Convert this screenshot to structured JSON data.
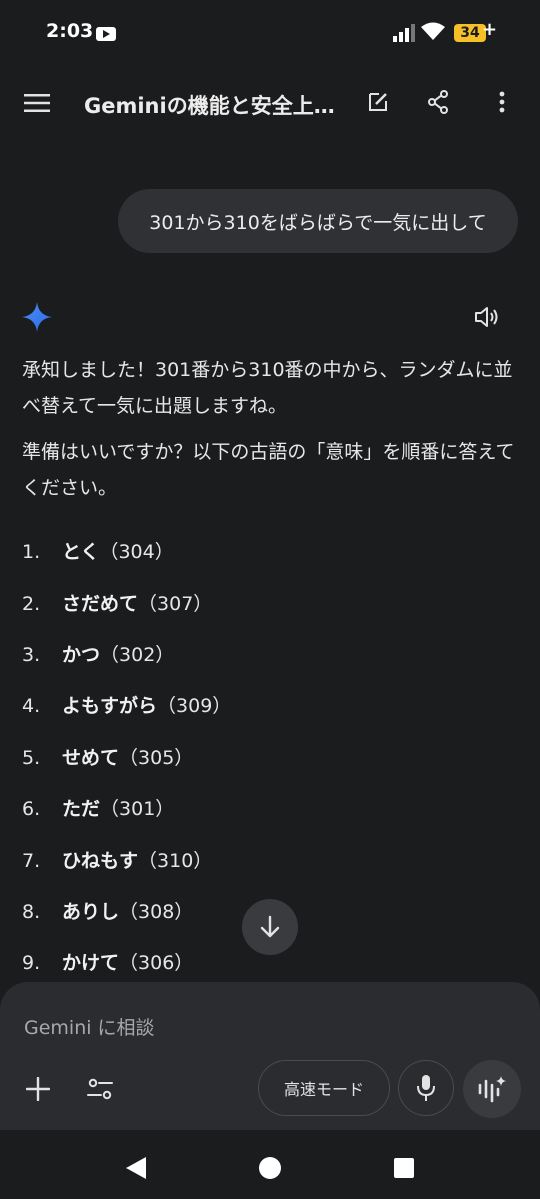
{
  "status_bar": {
    "time": "2:03",
    "battery": "34"
  },
  "app_bar": {
    "title": "Geminiの機能と安全上…"
  },
  "chat": {
    "user_message": "301から310をばらばらで一気に出して",
    "response_paragraphs": [
      "承知しました！301番から310番の中から、ランダムに並べ替えて一気に出題しますね。",
      "準備はいいですか？以下の古語の「意味」を順番に答えてください。"
    ],
    "items": [
      {
        "num": "1.",
        "word": "とく",
        "code": "（304）"
      },
      {
        "num": "2.",
        "word": "さだめて",
        "code": "（307）"
      },
      {
        "num": "3.",
        "word": "かつ",
        "code": "（302）"
      },
      {
        "num": "4.",
        "word": "よもすがら",
        "code": "（309）"
      },
      {
        "num": "5.",
        "word": "せめて",
        "code": "（305）"
      },
      {
        "num": "6.",
        "word": "ただ",
        "code": "（301）"
      },
      {
        "num": "7.",
        "word": "ひねもす",
        "code": "（310）"
      },
      {
        "num": "8.",
        "word": "ありし",
        "code": "（308）"
      },
      {
        "num": "9.",
        "word": "かけて",
        "code": "（306）"
      }
    ]
  },
  "composer": {
    "placeholder": "Gemini に相談",
    "mode_label": "高速モード"
  },
  "icons": {
    "menu": "menu-icon",
    "edit": "edit-icon",
    "share": "share-icon",
    "more": "more-vert-icon",
    "gemini": "gemini-star-icon",
    "speaker": "speaker-icon",
    "scroll": "arrow-down-icon",
    "add": "plus-icon",
    "tools": "tune-icon",
    "mic": "mic-icon",
    "live": "live-icon",
    "back": "back-icon",
    "home": "home-icon",
    "recents": "recents-icon"
  },
  "colors": {
    "background": "#1b1c1e",
    "bubble": "#303134",
    "battery": "#f6c026",
    "gemini_blue": "#4f8df5"
  }
}
